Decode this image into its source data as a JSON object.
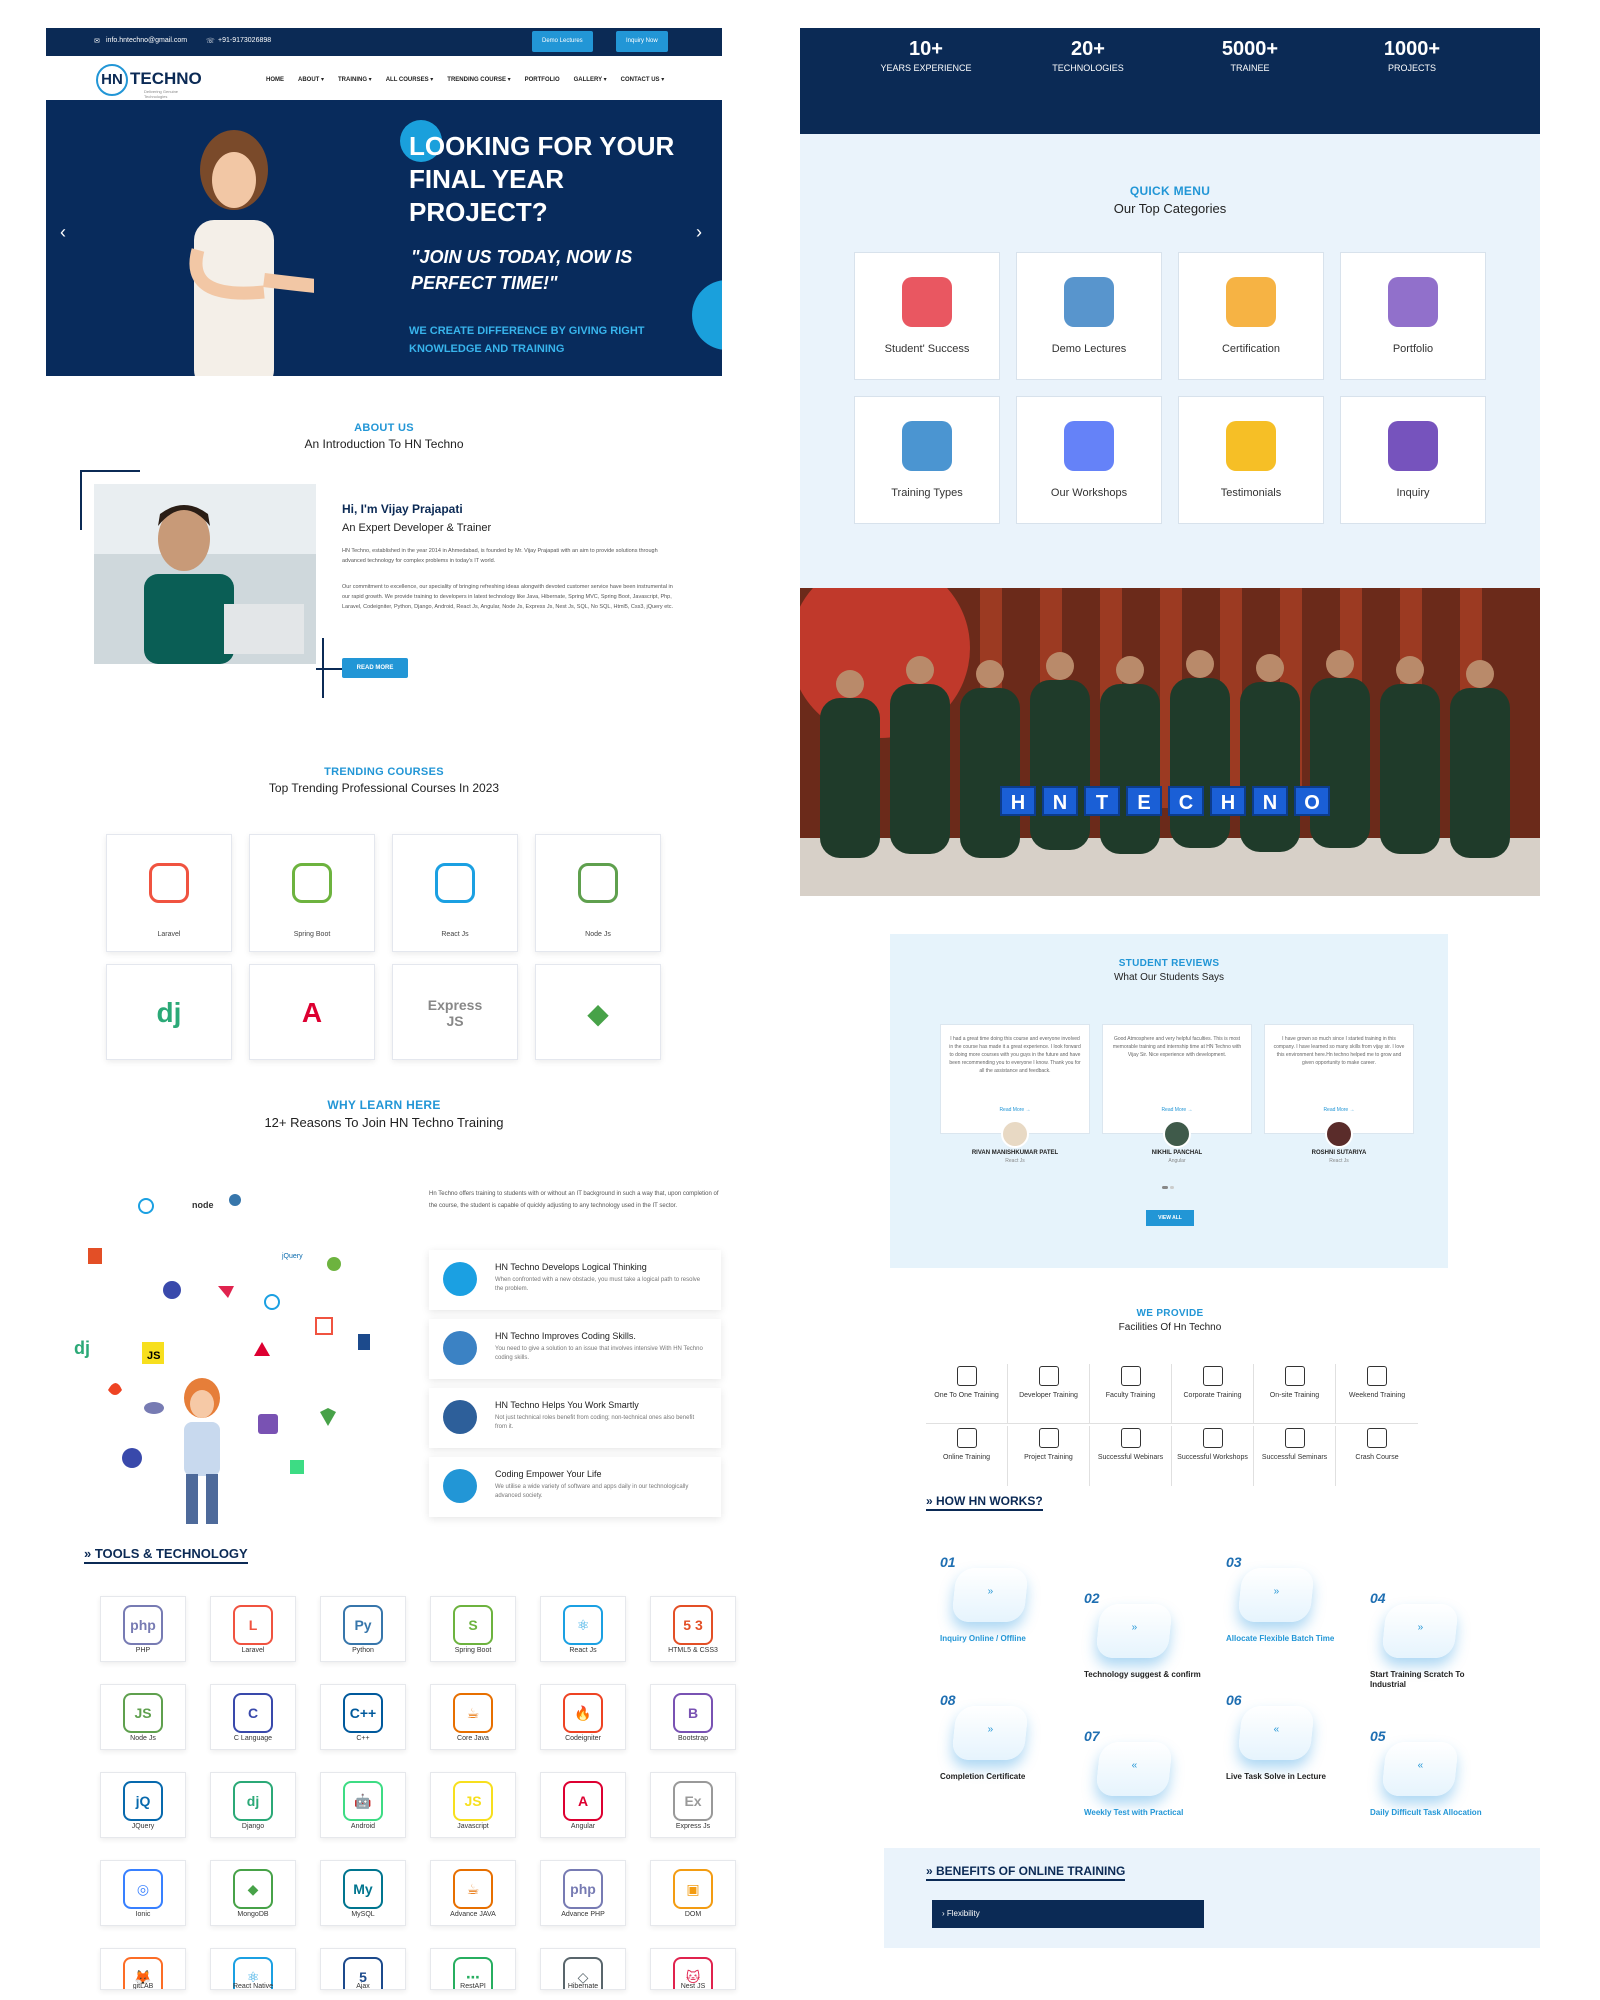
{
  "topbar": {
    "email": "info.hntechno@gmail.com",
    "phone": "+91-9173026898",
    "demo_btn": "Demo Lectures",
    "inquiry_btn": "Inquiry Now"
  },
  "brand": {
    "hn": "HN",
    "name": "TECHNO",
    "tagline": "Delivering Genuine Technologies"
  },
  "nav": [
    "HOME",
    "ABOUT ▾",
    "TRAINING ▾",
    "ALL COURSES ▾",
    "TRENDING COURSE ▾",
    "PORTFOLIO",
    "GALLERY ▾",
    "CONTACT US ▾"
  ],
  "hero": {
    "headline": "LOOKING FOR YOUR FINAL YEAR PROJECT?",
    "quote": "\"JOIN US TODAY, NOW IS PERFECT TIME!\"",
    "sub": "WE CREATE DIFFERENCE BY GIVING RIGHT KNOWLEDGE AND TRAINING",
    "prev": "‹",
    "next": "›"
  },
  "about": {
    "kicker": "ABOUT US",
    "subtitle": "An Introduction To HN Techno",
    "name": "Hi, I'm Vijay Prajapati",
    "role": "An Expert Developer & Trainer",
    "p1": "HN Techno, established in the year 2014 in Ahmedabad, is founded by Mr. Vijay Prajapati with an aim to provide solutions through advanced technology for complex problems in today's IT world.",
    "p2": "Our commitment to excellence, our speciality of bringing refreshing ideas alongwith devoted customer service have been instrumental in our rapid growth. We provide training to developers in latest technology like Java, Hibernate, Spring MVC, Spring Boot, Javascript, Php, Laravel, Codeigniter, Python, Django, Android, React Js, Angular, Node Js, Express Js, Nest Js, SQL, No SQL, Html5, Css3, jQuery etc.",
    "btn": "READ MORE"
  },
  "trending": {
    "kicker": "TRENDING COURSES",
    "subtitle": "Top Trending Professional Courses In 2023",
    "items": [
      {
        "label": "Laravel",
        "icon": "laravel-icon",
        "color": "#f05340"
      },
      {
        "label": "Spring Boot",
        "icon": "spring-boot-icon",
        "color": "#6db33f"
      },
      {
        "label": "React Js",
        "icon": "react-icon",
        "color": "#1ba0e2"
      },
      {
        "label": "Node Js",
        "icon": "nodejs-icon",
        "color": "#5fa04e"
      },
      {
        "label": "",
        "icon": "django-icon",
        "color": "#2ba977",
        "glyph": "dj"
      },
      {
        "label": "",
        "icon": "angular-icon",
        "color": "#dd0031",
        "glyph": "A"
      },
      {
        "label": "",
        "icon": "expressjs-icon",
        "color": "#f7df1e",
        "glyph": "Express JS"
      },
      {
        "label": "",
        "icon": "mongodb-icon",
        "color": "#47a248",
        "glyph": "◆"
      }
    ]
  },
  "why": {
    "kicker": "WHY LEARN HERE",
    "subtitle": "12+ Reasons To Join HN Techno Training",
    "intro": "Hn Techno offers training to students with or without an IT background in such a way that, upon completion of the course, the student is capable of quickly adjusting to any technology used in the IT sector.",
    "items": [
      {
        "title": "HN Techno Develops Logical Thinking",
        "desc": "When confronted with a new obstacle, you must take a logical path to resolve the problem."
      },
      {
        "title": "HN Techno Improves Coding Skills.",
        "desc": "You need to give a solution to an issue that involves intensive With HN Techno coding skills."
      },
      {
        "title": "HN Techno Helps You Work Smartly",
        "desc": "Not just technical roles benefit from coding; non-technical ones also benefit from it."
      },
      {
        "title": "Coding Empower Your Life",
        "desc": "We utilise a wide variety of software and apps daily in our technologically advanced society."
      }
    ]
  },
  "tools": {
    "title": "» TOOLS & TECHNOLOGY",
    "items": [
      {
        "label": "PHP",
        "glyph": "php",
        "color": "#777bb3"
      },
      {
        "label": "Laravel",
        "glyph": "L",
        "color": "#f05340"
      },
      {
        "label": "Python",
        "glyph": "Py",
        "color": "#3776ab"
      },
      {
        "label": "Spring Boot",
        "glyph": "S",
        "color": "#6db33f"
      },
      {
        "label": "React Js",
        "glyph": "⚛",
        "color": "#1ba0e2"
      },
      {
        "label": "HTML5 & CSS3",
        "glyph": "5 3",
        "color": "#e34f26"
      },
      {
        "label": "Node Js",
        "glyph": "JS",
        "color": "#5fa04e"
      },
      {
        "label": "C Language",
        "glyph": "C",
        "color": "#3949ab"
      },
      {
        "label": "C++",
        "glyph": "C++",
        "color": "#00599c"
      },
      {
        "label": "Core Java",
        "glyph": "☕",
        "color": "#e76f00"
      },
      {
        "label": "Codeigniter",
        "glyph": "🔥",
        "color": "#ee4323"
      },
      {
        "label": "Bootstrap",
        "glyph": "B",
        "color": "#7952b3"
      },
      {
        "label": "JQuery",
        "glyph": "jQ",
        "color": "#0769ad"
      },
      {
        "label": "Django",
        "glyph": "dj",
        "color": "#2ba977"
      },
      {
        "label": "Android",
        "glyph": "🤖",
        "color": "#3ddc84"
      },
      {
        "label": "Javascript",
        "glyph": "JS",
        "color": "#f7df1e"
      },
      {
        "label": "Angular",
        "glyph": "A",
        "color": "#dd0031"
      },
      {
        "label": "Express Js",
        "glyph": "Ex",
        "color": "#999999"
      },
      {
        "label": "Ionic",
        "glyph": "◎",
        "color": "#3880ff"
      },
      {
        "label": "MongoDB",
        "glyph": "◆",
        "color": "#47a248"
      },
      {
        "label": "MySQL",
        "glyph": "My",
        "color": "#00758f"
      },
      {
        "label": "Advance JAVA",
        "glyph": "☕",
        "color": "#e76f00"
      },
      {
        "label": "Advance PHP",
        "glyph": "php",
        "color": "#777bb3"
      },
      {
        "label": "DOM",
        "glyph": "▣",
        "color": "#f39c12"
      },
      {
        "label": "gitLAB",
        "glyph": "🦊",
        "color": "#fc6d26"
      },
      {
        "label": "React Native",
        "glyph": "⚛",
        "color": "#1ba0e2"
      },
      {
        "label": "Ajax",
        "glyph": "5",
        "color": "#1c4a8c"
      },
      {
        "label": "RestAPI",
        "glyph": "⋯",
        "color": "#27ae60"
      },
      {
        "label": "Hibernate",
        "glyph": "◇",
        "color": "#59666c"
      },
      {
        "label": "Nest JS",
        "glyph": "🐱",
        "color": "#e0234e"
      }
    ]
  },
  "stats": [
    {
      "n": "10+",
      "l": "YEARS EXPERIENCE"
    },
    {
      "n": "20+",
      "l": "TECHNOLOGIES"
    },
    {
      "n": "5000+",
      "l": "TRAINEE"
    },
    {
      "n": "1000+",
      "l": "PROJECTS"
    }
  ],
  "quick": {
    "kicker": "QUICK MENU",
    "subtitle": "Our Top Categories",
    "items": [
      {
        "label": "Student' Success",
        "icon": "target-icon",
        "color": "#e53945"
      },
      {
        "label": "Demo Lectures",
        "icon": "lecture-icon",
        "color": "#3b82c4"
      },
      {
        "label": "Certification",
        "icon": "certificate-icon",
        "color": "#f5a623"
      },
      {
        "label": "Portfolio",
        "icon": "portfolio-icon",
        "color": "#7e57c2"
      },
      {
        "label": "Training Types",
        "icon": "training-icon",
        "color": "#2c82c9"
      },
      {
        "label": "Our Workshops",
        "icon": "workshop-icon",
        "color": "#4a6cf7"
      },
      {
        "label": "Testimonials",
        "icon": "testimonial-icon",
        "color": "#f4b400"
      },
      {
        "label": "Inquiry",
        "icon": "inquiry-icon",
        "color": "#5e35b1"
      }
    ]
  },
  "group_photo": {
    "sign": [
      "H",
      "N",
      "T",
      "E",
      "C",
      "H",
      "N",
      "O"
    ]
  },
  "reviews": {
    "kicker": "STUDENT REVIEWS",
    "subtitle": "What Our Students Says",
    "items": [
      {
        "text": "I had a great time doing this course and everyone involved in the course has made it a great experience. I look forward to doing more courses with you guys in the future and have been recommending you to everyone I know. Thank you for all the assistance and feedback.",
        "more": "Read More →",
        "name": "RIVAN MANISHKUMAR PATEL",
        "role": "React Js"
      },
      {
        "text": "Good Atmosphere and very helpful faculties. This is most memorable training and internship time at HN Techno with Vijay Sir. Nice experience with development.",
        "more": "Read More →",
        "name": "NIKHIL PANCHAL",
        "role": "Angular"
      },
      {
        "text": "I have grown so much since I started training in this company. I have learned so many skills from vijay sir. I love this environment here.Hn techno helped me to grow and given opportunity to make career.",
        "more": "Read More →",
        "name": "ROSHNI SUTARIYA",
        "role": "React Js"
      }
    ],
    "btn": "VIEW ALL"
  },
  "facilities": {
    "kicker": "WE PROVIDE",
    "subtitle": "Facilities Of Hn Techno",
    "items": [
      "One To One Training",
      "Developer Training",
      "Faculty Training",
      "Corporate Training",
      "On-site Training",
      "Weekend Training",
      "Online Training",
      "Project Training",
      "Successful Webinars",
      "Successful Workshops",
      "Successful Seminars",
      "Crash Course"
    ]
  },
  "how": {
    "title": "» HOW HN WORKS?",
    "steps": [
      {
        "num": "01",
        "label": "Inquiry Online / Offline",
        "blue": true
      },
      {
        "num": "02",
        "label": "Technology suggest & confirm",
        "blue": false
      },
      {
        "num": "03",
        "label": "Allocate Flexible Batch Time",
        "blue": true
      },
      {
        "num": "04",
        "label": "Start Training Scratch To Industrial",
        "blue": false
      },
      {
        "num": "08",
        "label": "Completion Certificate",
        "blue": false
      },
      {
        "num": "07",
        "label": "Weekly Test with Practical",
        "blue": true
      },
      {
        "num": "06",
        "label": "Live Task Solve in Lecture",
        "blue": false
      },
      {
        "num": "05",
        "label": "Daily Difficult Task Allocation",
        "blue": true
      }
    ]
  },
  "benefits": {
    "title": "» BENEFITS OF ONLINE TRAINING",
    "item": "›   Flexibility"
  }
}
